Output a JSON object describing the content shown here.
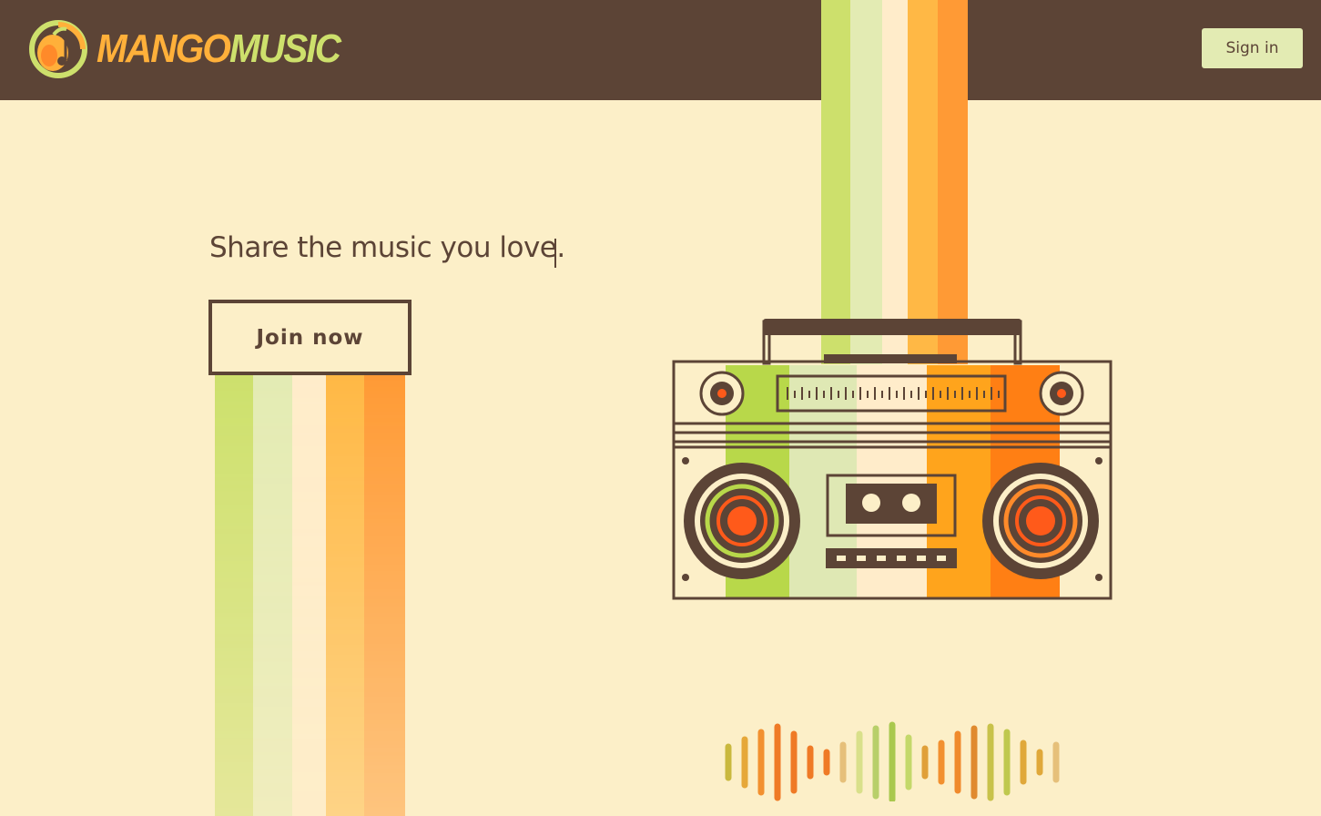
{
  "header": {
    "logo": {
      "brand_part1": "MANGO",
      "brand_part2": "MUSIC"
    },
    "signin_label": "Sign in"
  },
  "hero": {
    "tagline": "Share the music you love.",
    "join_label": "Join now"
  },
  "illustration": {
    "boombox": "boombox-icon",
    "soundwave": "soundwave-icon"
  },
  "colors": {
    "header_bg": "#5c4436",
    "page_bg": "#fcefc8",
    "brand_orange": "#ffb03a",
    "brand_green": "#cde06c",
    "signin_bg": "#e3ebb3",
    "stripe_colors": [
      "#cde06c",
      "#e3ebb3",
      "#ffeecd",
      "#ffb845",
      "#ff9a35"
    ]
  }
}
